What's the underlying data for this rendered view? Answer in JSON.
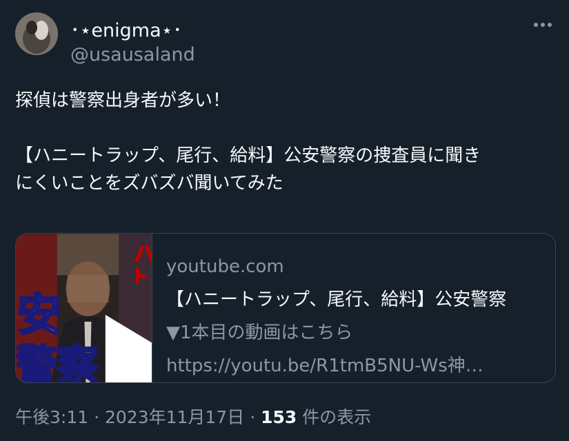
{
  "author": {
    "display_name": "･⋆enigma⋆･",
    "handle": "@usausaland"
  },
  "tweet": {
    "text_line1": "探偵は警察出身者が多い！",
    "text_line2": "【ハニートラップ、尾行、給料】公安警察の捜査員に聞き\nにくいことをズバズバ聞いてみた"
  },
  "card": {
    "domain": "youtube.com",
    "title": "【ハニートラップ、尾行、給料】公安警察",
    "desc1": "▼1本目の動画はこちら",
    "desc2": "https://youtu.be/R1tmB5NU-Ws神…",
    "thumbnail": {
      "big_text_1": "安",
      "big_text_2": "警察",
      "side_text": "ハ",
      "side_text2": "ト"
    }
  },
  "footer": {
    "time": "午後3:11",
    "sep1": "·",
    "date": "2023年11月17日",
    "sep2": "·",
    "views_count": "153",
    "views_label": "件の表示"
  },
  "colors": {
    "background": "#15202b",
    "text_primary": "#f7f9f9",
    "text_secondary": "#8b98a5",
    "border": "#38444d"
  },
  "icons": {
    "more": "more-horizontal-icon",
    "play": "play-icon"
  }
}
